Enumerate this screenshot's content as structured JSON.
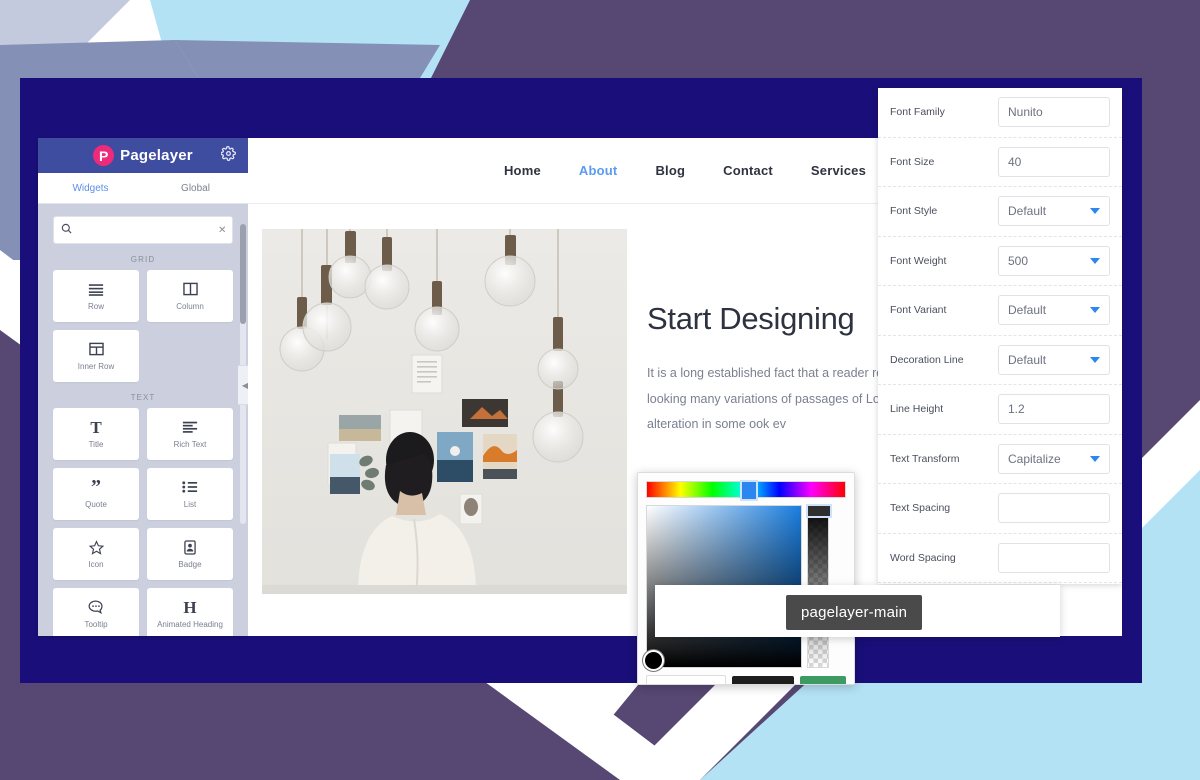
{
  "background": {
    "colors": {
      "purple": "#564773",
      "slate_blue": "#8490b5",
      "light_blue": "#b3e2f5",
      "pale_blue": "#c3cade",
      "white": "#ffffff",
      "navy_frame": "#1a0f7a"
    }
  },
  "sidebar": {
    "brand": "Pagelayer",
    "gear_icon": "gear-icon",
    "logo_letter": "P",
    "tabs": [
      {
        "label": "Widgets",
        "active": true
      },
      {
        "label": "Global",
        "active": false
      }
    ],
    "search": {
      "value": "",
      "placeholder": "",
      "search_icon": "search-icon",
      "clear_icon": "close-icon"
    },
    "groups": [
      {
        "label": "GRID",
        "widgets": [
          {
            "label": "Row",
            "icon": "rows-icon"
          },
          {
            "label": "Column",
            "icon": "columns-icon"
          },
          {
            "label": "Inner Row",
            "icon": "inner-row-icon"
          }
        ]
      },
      {
        "label": "TEXT",
        "widgets": [
          {
            "label": "Title",
            "icon": "serif-t-icon"
          },
          {
            "label": "Rich Text",
            "icon": "align-left-icon"
          },
          {
            "label": "Quote",
            "icon": "quote-icon"
          },
          {
            "label": "List",
            "icon": "list-icon"
          },
          {
            "label": "Icon",
            "icon": "star-icon"
          },
          {
            "label": "Badge",
            "icon": "badge-icon"
          },
          {
            "label": "Tooltip",
            "icon": "speech-bubble-icon"
          },
          {
            "label": "Animated Heading",
            "icon": "serif-h-icon"
          }
        ]
      }
    ],
    "collapse_icon": "chevron-left-icon"
  },
  "canvas": {
    "nav": [
      {
        "label": "Home",
        "active": false
      },
      {
        "label": "About",
        "active": true
      },
      {
        "label": "Blog",
        "active": false
      },
      {
        "label": "Contact",
        "active": false
      },
      {
        "label": "Services",
        "active": false
      }
    ],
    "hero": {
      "photo_alt": "person-facing-moodboard-wall-with-hanging-bulbs",
      "heading": "Start Designing",
      "paragraph": "It is a long established fact that a reader readable content of a page when looking many variations of passages of Lorem Ips majority have suffered alteration in some ook ev"
    }
  },
  "color_picker": {
    "hue_selected_hex": "#2b86f0",
    "current_hex": "#1a7ee0",
    "swatch_dark": "#1d1d1d",
    "swatch_green": "#3e9a63",
    "hex_input_value": ""
  },
  "style_panel": {
    "fields": [
      {
        "label": "Font Family",
        "value": "Nunito",
        "type": "text",
        "placeholder": false
      },
      {
        "label": "Font Size",
        "value": "40",
        "type": "text",
        "placeholder": false
      },
      {
        "label": "Font Style",
        "value": "Default",
        "type": "select",
        "placeholder": false
      },
      {
        "label": "Font Weight",
        "value": "500",
        "type": "select",
        "placeholder": false
      },
      {
        "label": "Font Variant",
        "value": "Default",
        "type": "select",
        "placeholder": false
      },
      {
        "label": "Decoration Line",
        "value": "Default",
        "type": "select",
        "placeholder": false
      },
      {
        "label": "Line Height",
        "value": "1.2",
        "type": "text",
        "placeholder": false
      },
      {
        "label": "Text Transform",
        "value": "Capitalize",
        "type": "select",
        "placeholder": false
      },
      {
        "label": "Text Spacing",
        "value": "",
        "type": "text",
        "placeholder": true
      },
      {
        "label": "Word Spacing",
        "value": "",
        "type": "text",
        "placeholder": true
      }
    ]
  },
  "tooltip": {
    "text": "pagelayer-main"
  }
}
